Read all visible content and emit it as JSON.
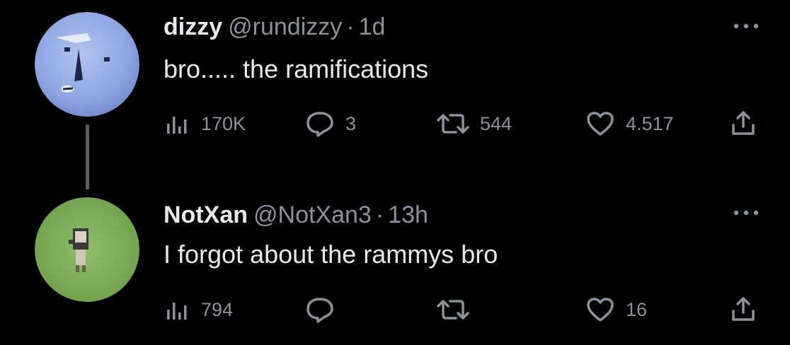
{
  "tweets": [
    {
      "name": "dizzy",
      "handle": "@rundizzy",
      "separator": "·",
      "time": "1d",
      "text": "bro..... the ramifications",
      "avatar_icon": "blue-moai-face-avatar",
      "views": "170K",
      "replies": "3",
      "retweets": "544",
      "likes": "4.517"
    },
    {
      "name": "NotXan",
      "handle": "@NotXan3",
      "separator": "·",
      "time": "13h",
      "text": "I forgot about the rammys bro",
      "avatar_icon": "green-field-figure-avatar",
      "views": "794",
      "replies": "",
      "retweets": "",
      "likes": "16"
    }
  ],
  "colors": {
    "background": "#000000",
    "primary_text": "#e7e9ea",
    "secondary_text": "#8b9299",
    "avatar_blue": "#8fa6e3",
    "avatar_green": "#86b461"
  }
}
